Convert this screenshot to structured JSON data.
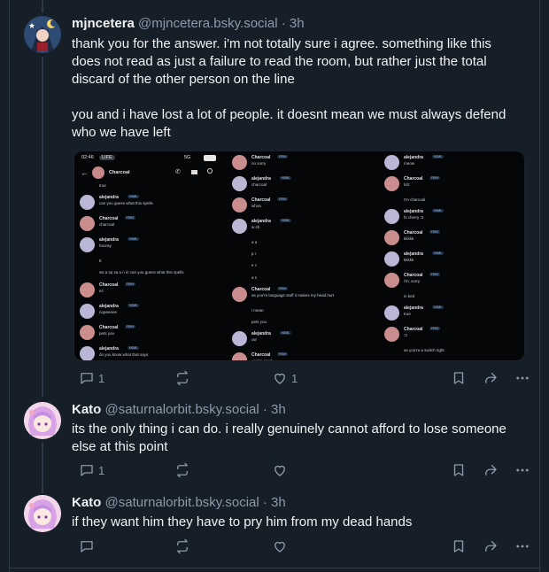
{
  "posts": [
    {
      "author": "mjncetera",
      "handle": "@mjncetera.bsky.social",
      "time": "· 3h",
      "paragraphs": [
        "thank you for the answer. i'm not totally sure i agree. something like this does not read as just a failure to read the room, but rather just the total discard of the other person on the line",
        "you and i have lost a lot of people. it doesnt mean we must always defend who we have left"
      ],
      "replies": "1",
      "reposts": "",
      "likes": "1"
    },
    {
      "author": "Kato",
      "handle": "@saturnalorbit.bsky.social",
      "time": "· 3h",
      "paragraphs": [
        "its the only thing i can do. i really genuinely cannot afford to lose someone else at this point"
      ],
      "replies": "1",
      "reposts": "",
      "likes": ""
    },
    {
      "author": "Kato",
      "handle": "@saturnalorbit.bsky.social",
      "time": "· 3h",
      "paragraphs": [
        "if they want him they have to pry him from my dead hands"
      ],
      "replies": "",
      "reposts": "",
      "likes": ""
    }
  ],
  "embed": {
    "status_time": "02:46",
    "status_badge": "LIFE",
    "status_right": "5G",
    "channel": "Charcoal",
    "col1": [
      {
        "name": "",
        "body": "true"
      },
      {
        "name": "alejandra",
        "tag": "HJML",
        "body": "can you guess what this spells"
      },
      {
        "name": "Charcoal",
        "tag": "FISH",
        "body": "charcoal"
      },
      {
        "name": "alejandra",
        "tag": "HJML",
        "body": "hooray"
      },
      {
        "name": "",
        "body": "tt"
      },
      {
        "name": "",
        "body": "ws a sp sa a n in can you guess what this spells"
      },
      {
        "name": "Charcoal",
        "tag": "FISH",
        "body": "ez"
      },
      {
        "name": "alejandra",
        "tag": "HJML",
        "body": "nopeeeee"
      },
      {
        "name": "Charcoal",
        "tag": "FISH",
        "body": "pets you"
      },
      {
        "name": "alejandra",
        "tag": "HJML",
        "body": "do you know what that says"
      }
    ],
    "col2": [
      {
        "name": "Charcoal",
        "tag": "FISH",
        "body": "no sorry"
      },
      {
        "name": "alejandra",
        "tag": "HJML",
        "body": "charcoal"
      },
      {
        "name": "Charcoal",
        "tag": "FISH",
        "body": "whoa"
      },
      {
        "name": "alejandra",
        "tag": "HJML",
        "body": "w sh"
      },
      {
        "name": "",
        "body": "a a"
      },
      {
        "name": "",
        "body": "p r"
      },
      {
        "name": "",
        "body": "e c"
      },
      {
        "name": "",
        "body": "a n"
      },
      {
        "name": "Charcoal",
        "tag": "FISH",
        "body": "as you're language stuff it makes my head hurt"
      },
      {
        "name": "",
        "body": "i mean"
      },
      {
        "name": "",
        "body": "pets you"
      },
      {
        "name": "alejandra",
        "tag": "HJML",
        "body": "ow"
      },
      {
        "name": "Charcoal",
        "tag": "FISH",
        "body": "you're good"
      },
      {
        "name": "",
        "body": ":3"
      }
    ],
    "col3": [
      {
        "name": "alejandra",
        "tag": "HJML",
        "body": "meow"
      },
      {
        "name": "Charcoal",
        "tag": "FISH",
        "body": "lolz"
      },
      {
        "name": "",
        "body": "I'm charcoal"
      },
      {
        "name": "alejandra",
        "tag": "HJML",
        "body": "hi cherry :3"
      },
      {
        "name": "Charcoal",
        "tag": "FISH",
        "body": "kkkkk"
      },
      {
        "name": "alejandra",
        "tag": "HJML",
        "body": "kkkkk"
      },
      {
        "name": "Charcoal",
        "tag": "FISH",
        "body": "i'm, sorry"
      },
      {
        "name": "",
        "body": "in bed"
      },
      {
        "name": "alejandra",
        "tag": "HJML",
        "body": "true"
      },
      {
        "name": "Charcoal",
        "tag": "FISH",
        "body": ":3"
      },
      {
        "name": "",
        "body": "as you're a switch right"
      },
      {
        "name": "",
        "body": "meow"
      },
      {
        "name": "",
        "body": "i wanna get pinned"
      }
    ]
  },
  "colors": {
    "background": "#161e27",
    "border": "#2e3a48",
    "muted": "#8d9bac",
    "text": "#f1f3f5"
  },
  "icons": [
    "reply-icon",
    "repost-icon",
    "like-icon",
    "bookmark-icon",
    "share-icon",
    "more-icon"
  ]
}
